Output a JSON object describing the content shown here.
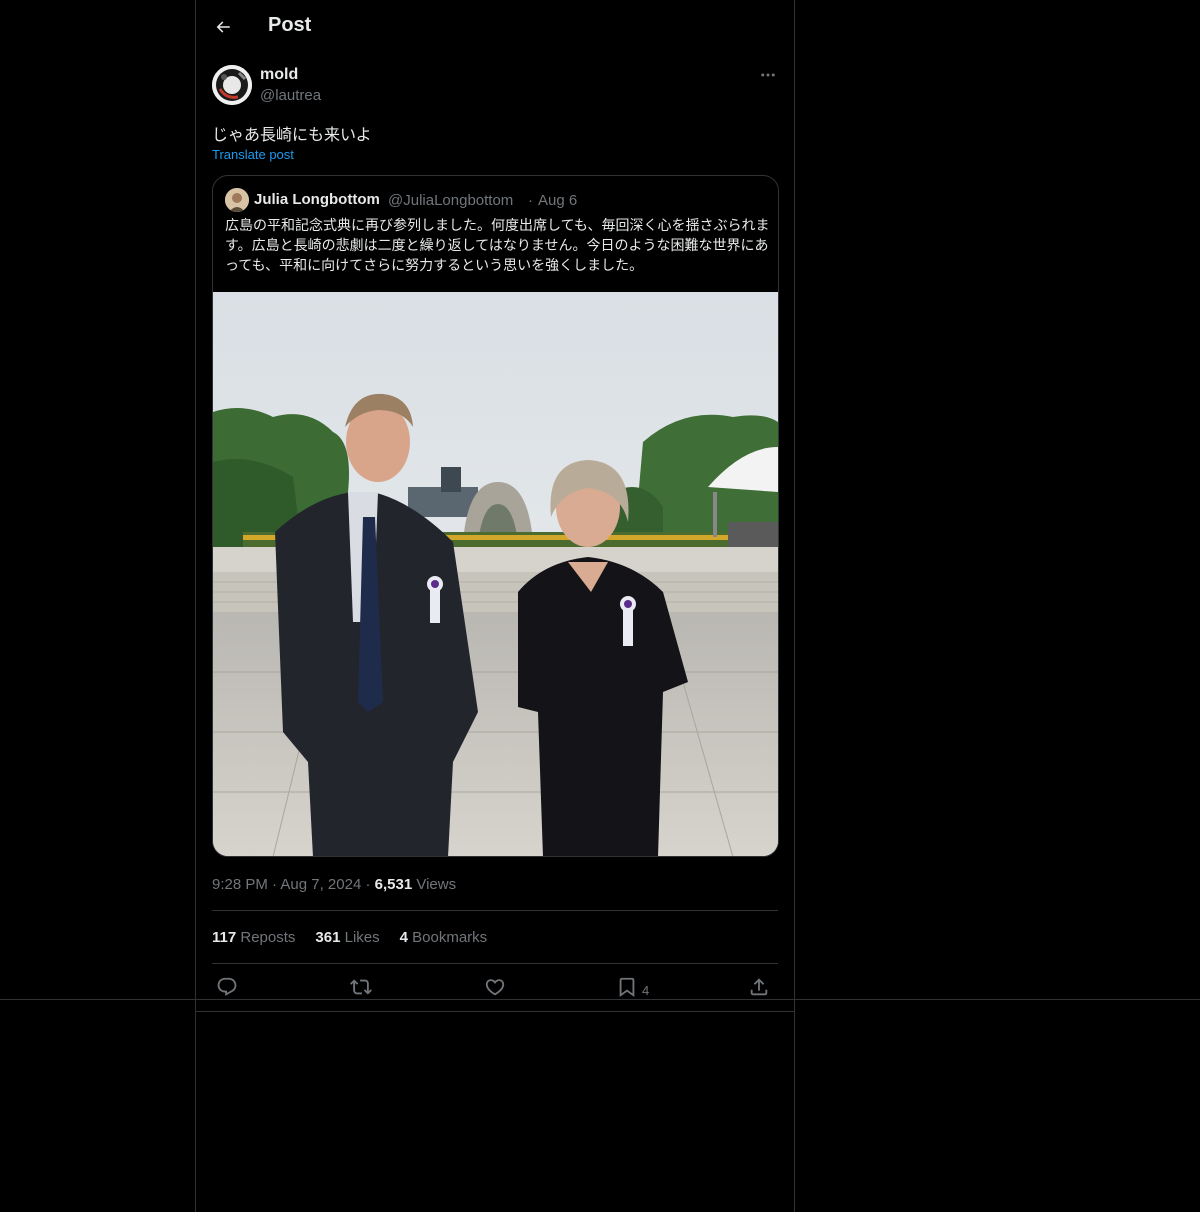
{
  "header": {
    "title": "Post"
  },
  "post": {
    "author_name": "mold",
    "author_handle": "@lautrea",
    "text": "じゃあ長崎にも来いよ",
    "translate_label": "Translate post",
    "time": "9:28 PM",
    "date": "Aug 7, 2024",
    "views_count": "6,531",
    "views_label": "Views",
    "reposts_count": "117",
    "reposts_label": "Reposts",
    "likes_count": "361",
    "likes_label": "Likes",
    "bookmarks_count": "4",
    "bookmarks_label": "Bookmarks",
    "bookmark_action_count": "4"
  },
  "quote": {
    "author_name": "Julia Longbottom",
    "author_handle": "@JuliaLongbottom",
    "date": "Aug 6",
    "text": "広島の平和記念式典に再び参列しました。何度出席しても、毎回深く心を揺さぶられます。広島と長崎の悲劇は二度と繰り返してはなりません。今日のような困難な世界にあっても、平和に向けてさらに努力するという思いを強くしました。"
  },
  "icons": {
    "back": "arrow-left-icon",
    "more": "more-horizontal-icon",
    "reply": "reply-icon",
    "repost": "repost-icon",
    "like": "heart-icon",
    "bookmark": "bookmark-icon",
    "share": "share-icon"
  },
  "colors": {
    "background": "#000000",
    "text": "#e7e9ea",
    "muted": "#71767b",
    "link": "#1d9bf0",
    "border": "#2f3336"
  }
}
